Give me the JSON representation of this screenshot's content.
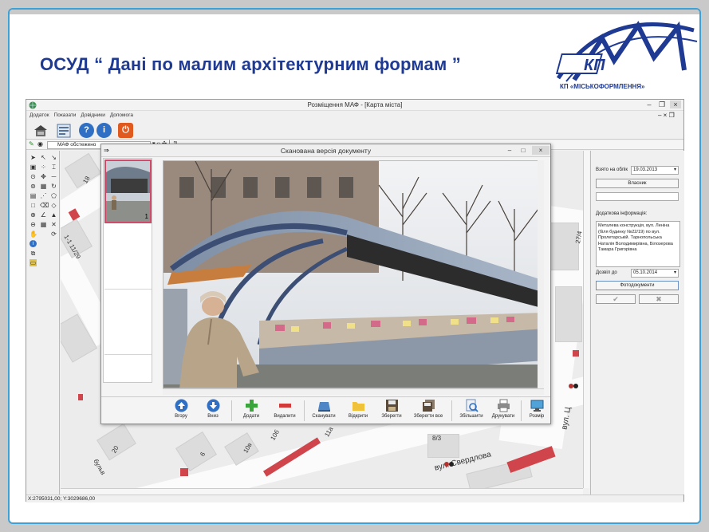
{
  "slide": {
    "heading": "ОСУД “ Дані по малим архітектурним формам ”",
    "logo_mark": "КП",
    "logo_caption": "КП «МІСЬКОФОРМЛЕННЯ»"
  },
  "window": {
    "title": "Розміщення МАФ - [Карта міста]",
    "menu": [
      "Додаток",
      "Показати",
      "Довідники",
      "Допомога"
    ],
    "layer_name": "МАФ обстежено",
    "status": "X:2795031,00; Y:3029686,00"
  },
  "map_labels": {
    "n18": "18",
    "n1_1123": "1-1 11/29",
    "n27_4": "27/4",
    "n20": "20",
    "n6": "6",
    "n10v": "10в",
    "n10b": "10б",
    "n11a": "11а",
    "n8_3": "8/3",
    "street_boul": "бульв",
    "street_sverdlova": "вул. Свердлова",
    "street_vul": "вул. Ц"
  },
  "right_panel": {
    "taken_label": "Взято на облік",
    "taken_date": "19.03.2013",
    "owner_button": "Власник",
    "owner_value": "",
    "extra_label": "Додаткова інформація:",
    "extra_text": "Металева конструкція, вул. Леніна (біля будинку №22/19) по вул. Пролетарській. Тарнопольська Наталія Володимирівна, Білозерова Тамара Григорівна",
    "permit_label": "Дозвіл до",
    "permit_date": "05.10.2014",
    "photo_button": "Фотодокументи",
    "ok_icon": "check-icon",
    "cancel_icon": "cross-icon"
  },
  "dialog": {
    "title": "Сканована версія документу",
    "thumb_number": "1",
    "buttons": {
      "up": "Вгору",
      "down": "Вниз",
      "add": "Додати",
      "delete": "Видалити",
      "scan": "Сканувати",
      "open": "Відкрити",
      "save": "Зберегти",
      "save_all": "Зберегти все",
      "zoom": "Збільшити",
      "print": "Друкувати",
      "size": "Розмір"
    }
  },
  "colors": {
    "accent_blue": "#1f3a93",
    "slide_border": "#3aa2d8",
    "building_red": "#d0454b",
    "selection_pink": "#d24a6a"
  }
}
